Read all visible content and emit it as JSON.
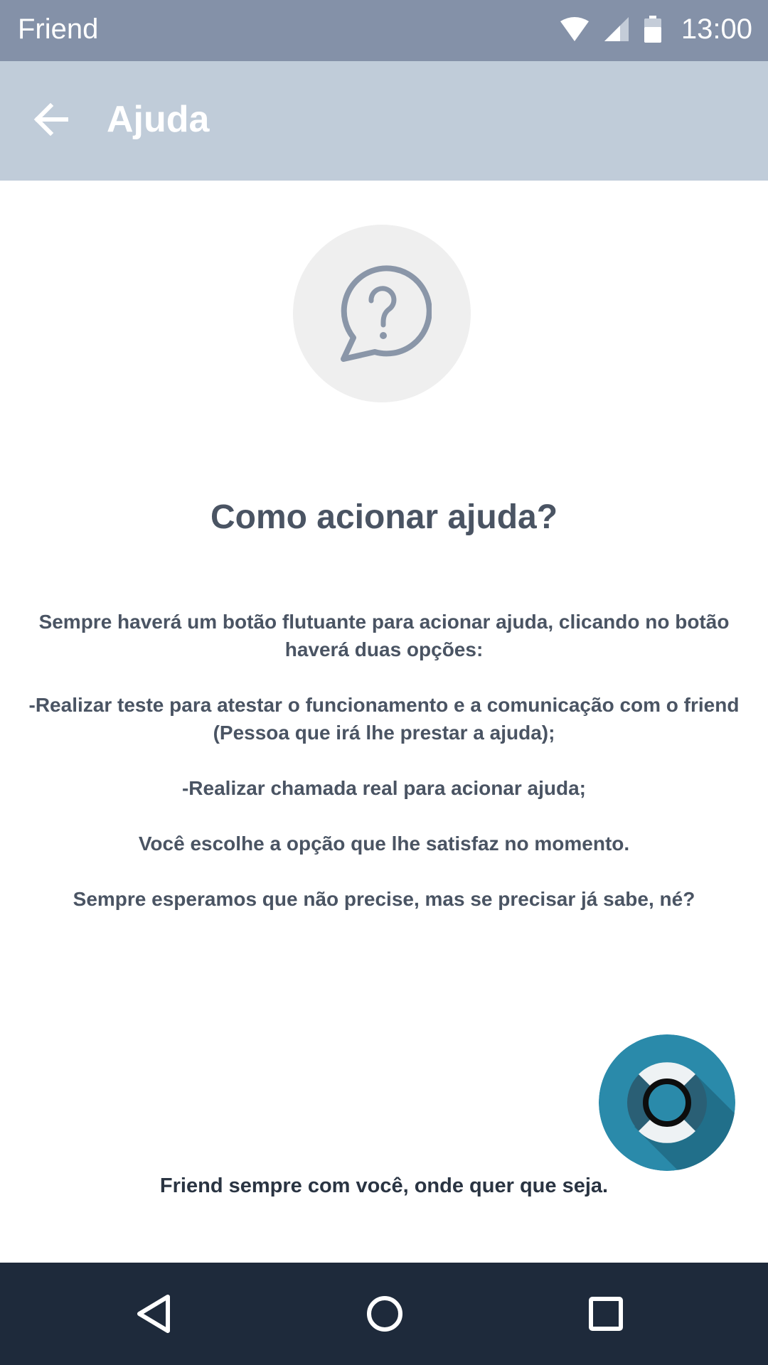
{
  "status_bar": {
    "app_name": "Friend",
    "time": "13:00",
    "icons": [
      "wifi-icon",
      "signal-icon",
      "battery-icon"
    ]
  },
  "app_bar": {
    "title": "Ajuda",
    "back_icon": "arrow-left-icon"
  },
  "help_icon": "question-bubble-icon",
  "main": {
    "heading": "Como acionar ajuda?",
    "paragraphs": [
      "Sempre haverá um botão flutuante para acionar ajuda, clicando no botão haverá duas opções:",
      "-Realizar teste para atestar o funcionamento e a comunicação com o friend (Pessoa que irá lhe prestar a ajuda);",
      "-Realizar chamada real para acionar ajuda;",
      "Você escolhe a opção que lhe satisfaz no momento.",
      "Sempre esperamos que não precise, mas se precisar já sabe, né?"
    ],
    "footer": "Friend sempre com você, onde quer que seja."
  },
  "fab": {
    "icon": "lifebuoy-icon"
  },
  "nav_bar": {
    "icons": [
      "back-triangle-icon",
      "home-circle-icon",
      "recents-square-icon"
    ]
  },
  "colors": {
    "status_bar": "#8491a8",
    "app_bar": "#c0ccd9",
    "text": "#4a5463",
    "fab": "#2a8aaa",
    "nav_bar": "#1e2a3b"
  }
}
